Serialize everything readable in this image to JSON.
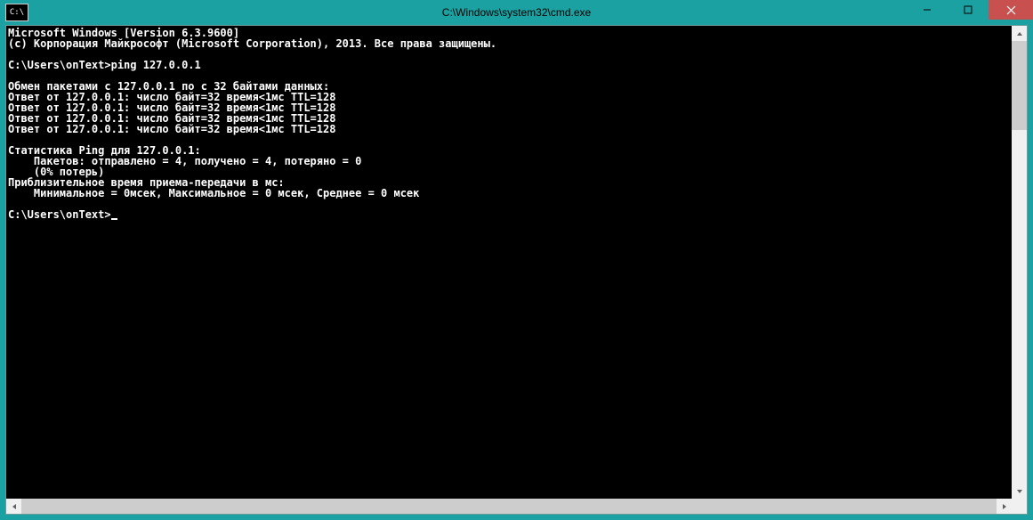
{
  "window": {
    "title": "C:\\Windows\\system32\\cmd.exe"
  },
  "console": {
    "lines": [
      "Microsoft Windows [Version 6.3.9600]",
      "(c) Корпорация Майкрософт (Microsoft Corporation), 2013. Все права защищены.",
      "",
      "C:\\Users\\onText>ping 127.0.0.1",
      "",
      "Обмен пакетами с 127.0.0.1 по с 32 байтами данных:",
      "Ответ от 127.0.0.1: число байт=32 время<1мс TTL=128",
      "Ответ от 127.0.0.1: число байт=32 время<1мс TTL=128",
      "Ответ от 127.0.0.1: число байт=32 время<1мс TTL=128",
      "Ответ от 127.0.0.1: число байт=32 время<1мс TTL=128",
      "",
      "Статистика Ping для 127.0.0.1:",
      "    Пакетов: отправлено = 4, получено = 4, потеряно = 0",
      "    (0% потерь)",
      "Приблизительное время приема-передачи в мс:",
      "    Минимальное = 0мсек, Максимальное = 0 мсек, Среднее = 0 мсек",
      "",
      "C:\\Users\\onText>"
    ],
    "prompt_has_cursor": true
  },
  "icons": {
    "app": "C:\\",
    "minimize": "minimize-icon",
    "maximize": "maximize-icon",
    "close": "close-icon"
  }
}
